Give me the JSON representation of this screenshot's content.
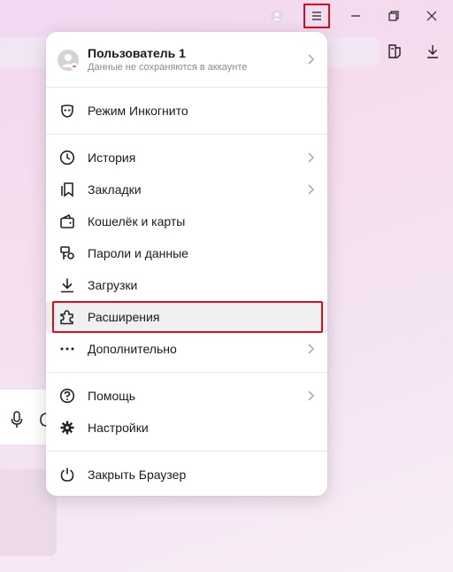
{
  "profile": {
    "name": "Пользователь 1",
    "subtitle": "Данные не сохраняются в аккаунте"
  },
  "menu": {
    "incognito": "Режим Инкогнито",
    "history": "История",
    "bookmarks": "Закладки",
    "wallet": "Кошелёк и карты",
    "passwords": "Пароли и данные",
    "downloads": "Загрузки",
    "extensions": "Расширения",
    "more": "Дополнительно",
    "help": "Помощь",
    "settings": "Настройки",
    "quit": "Закрыть Браузер"
  },
  "colors": {
    "highlight": "#d40f1e",
    "menu_bg": "#ffffff"
  },
  "icons": [
    "profile-icon",
    "menu-icon",
    "minimize-icon",
    "restore-icon",
    "close-icon",
    "collections-icon",
    "download-icon",
    "microphone-icon",
    "incognito-icon",
    "history-icon",
    "bookmarks-icon",
    "wallet-icon",
    "passwords-icon",
    "downloads-icon",
    "extensions-icon",
    "more-icon",
    "help-icon",
    "settings-icon",
    "power-icon"
  ]
}
